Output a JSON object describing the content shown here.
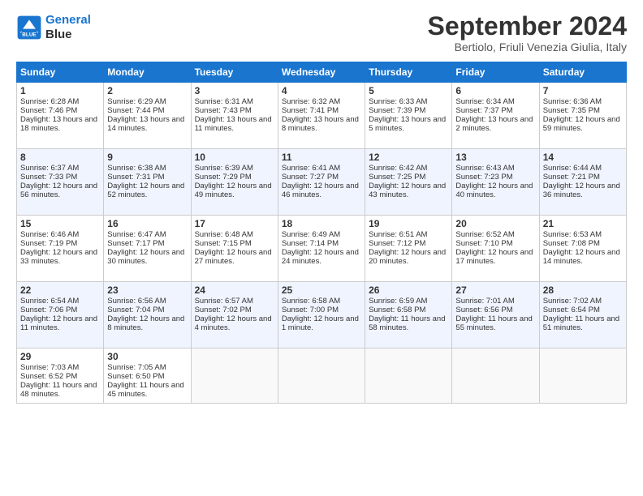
{
  "header": {
    "logo_line1": "General",
    "logo_line2": "Blue",
    "month": "September 2024",
    "location": "Bertiolo, Friuli Venezia Giulia, Italy"
  },
  "days": [
    "Sunday",
    "Monday",
    "Tuesday",
    "Wednesday",
    "Thursday",
    "Friday",
    "Saturday"
  ],
  "weeks": [
    [
      {
        "day": "1",
        "sunrise": "6:28 AM",
        "sunset": "7:46 PM",
        "daylight": "13 hours and 18 minutes."
      },
      {
        "day": "2",
        "sunrise": "6:29 AM",
        "sunset": "7:44 PM",
        "daylight": "13 hours and 14 minutes."
      },
      {
        "day": "3",
        "sunrise": "6:31 AM",
        "sunset": "7:43 PM",
        "daylight": "13 hours and 11 minutes."
      },
      {
        "day": "4",
        "sunrise": "6:32 AM",
        "sunset": "7:41 PM",
        "daylight": "13 hours and 8 minutes."
      },
      {
        "day": "5",
        "sunrise": "6:33 AM",
        "sunset": "7:39 PM",
        "daylight": "13 hours and 5 minutes."
      },
      {
        "day": "6",
        "sunrise": "6:34 AM",
        "sunset": "7:37 PM",
        "daylight": "13 hours and 2 minutes."
      },
      {
        "day": "7",
        "sunrise": "6:36 AM",
        "sunset": "7:35 PM",
        "daylight": "12 hours and 59 minutes."
      }
    ],
    [
      {
        "day": "8",
        "sunrise": "6:37 AM",
        "sunset": "7:33 PM",
        "daylight": "12 hours and 56 minutes."
      },
      {
        "day": "9",
        "sunrise": "6:38 AM",
        "sunset": "7:31 PM",
        "daylight": "12 hours and 52 minutes."
      },
      {
        "day": "10",
        "sunrise": "6:39 AM",
        "sunset": "7:29 PM",
        "daylight": "12 hours and 49 minutes."
      },
      {
        "day": "11",
        "sunrise": "6:41 AM",
        "sunset": "7:27 PM",
        "daylight": "12 hours and 46 minutes."
      },
      {
        "day": "12",
        "sunrise": "6:42 AM",
        "sunset": "7:25 PM",
        "daylight": "12 hours and 43 minutes."
      },
      {
        "day": "13",
        "sunrise": "6:43 AM",
        "sunset": "7:23 PM",
        "daylight": "12 hours and 40 minutes."
      },
      {
        "day": "14",
        "sunrise": "6:44 AM",
        "sunset": "7:21 PM",
        "daylight": "12 hours and 36 minutes."
      }
    ],
    [
      {
        "day": "15",
        "sunrise": "6:46 AM",
        "sunset": "7:19 PM",
        "daylight": "12 hours and 33 minutes."
      },
      {
        "day": "16",
        "sunrise": "6:47 AM",
        "sunset": "7:17 PM",
        "daylight": "12 hours and 30 minutes."
      },
      {
        "day": "17",
        "sunrise": "6:48 AM",
        "sunset": "7:15 PM",
        "daylight": "12 hours and 27 minutes."
      },
      {
        "day": "18",
        "sunrise": "6:49 AM",
        "sunset": "7:14 PM",
        "daylight": "12 hours and 24 minutes."
      },
      {
        "day": "19",
        "sunrise": "6:51 AM",
        "sunset": "7:12 PM",
        "daylight": "12 hours and 20 minutes."
      },
      {
        "day": "20",
        "sunrise": "6:52 AM",
        "sunset": "7:10 PM",
        "daylight": "12 hours and 17 minutes."
      },
      {
        "day": "21",
        "sunrise": "6:53 AM",
        "sunset": "7:08 PM",
        "daylight": "12 hours and 14 minutes."
      }
    ],
    [
      {
        "day": "22",
        "sunrise": "6:54 AM",
        "sunset": "7:06 PM",
        "daylight": "12 hours and 11 minutes."
      },
      {
        "day": "23",
        "sunrise": "6:56 AM",
        "sunset": "7:04 PM",
        "daylight": "12 hours and 8 minutes."
      },
      {
        "day": "24",
        "sunrise": "6:57 AM",
        "sunset": "7:02 PM",
        "daylight": "12 hours and 4 minutes."
      },
      {
        "day": "25",
        "sunrise": "6:58 AM",
        "sunset": "7:00 PM",
        "daylight": "12 hours and 1 minute."
      },
      {
        "day": "26",
        "sunrise": "6:59 AM",
        "sunset": "6:58 PM",
        "daylight": "11 hours and 58 minutes."
      },
      {
        "day": "27",
        "sunrise": "7:01 AM",
        "sunset": "6:56 PM",
        "daylight": "11 hours and 55 minutes."
      },
      {
        "day": "28",
        "sunrise": "7:02 AM",
        "sunset": "6:54 PM",
        "daylight": "11 hours and 51 minutes."
      }
    ],
    [
      {
        "day": "29",
        "sunrise": "7:03 AM",
        "sunset": "6:52 PM",
        "daylight": "11 hours and 48 minutes."
      },
      {
        "day": "30",
        "sunrise": "7:05 AM",
        "sunset": "6:50 PM",
        "daylight": "11 hours and 45 minutes."
      },
      null,
      null,
      null,
      null,
      null
    ]
  ]
}
